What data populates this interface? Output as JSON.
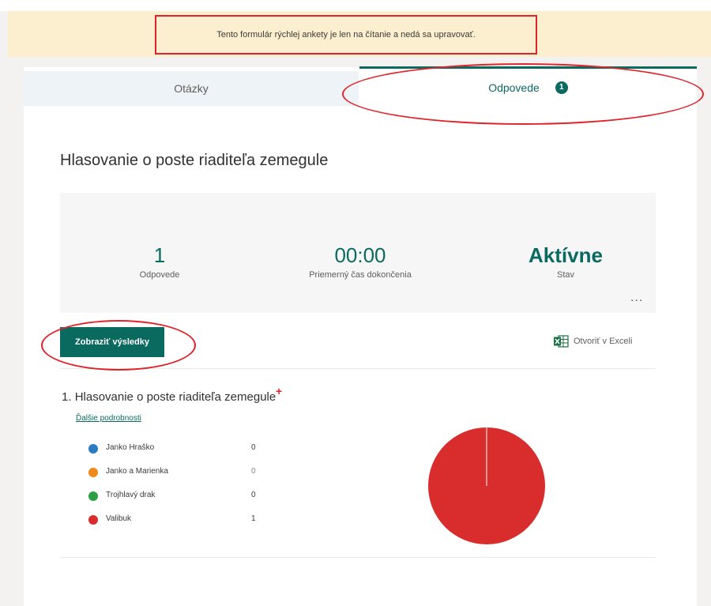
{
  "banner": {
    "message": "Tento formulár rýchlej ankety je len na čítanie a nedá sa upravovať."
  },
  "tabs": [
    {
      "label": "Otázky",
      "selected": false
    },
    {
      "label": "Odpovede",
      "badge": "1",
      "selected": true
    }
  ],
  "form": {
    "title": "Hlasovanie o poste riaditeľa zemegule"
  },
  "stats": {
    "responses": {
      "value": "1",
      "label": "Odpovede"
    },
    "avg_time": {
      "value": "00:00",
      "label": "Priemerný čas dokončenia"
    },
    "status": {
      "value": "Aktívne",
      "label": "Stav"
    },
    "more": "..."
  },
  "actions": {
    "view_results": "Zobraziť výsledky",
    "open_excel": "Otvoriť v Exceli"
  },
  "question": {
    "number": "1.",
    "title": "Hlasovanie o poste riaditeľa zemegule",
    "details_link": "Ďalšie podrobnosti",
    "options": [
      {
        "name": "Janko Hraško",
        "count": "0",
        "color": "#2b7bc0"
      },
      {
        "name": "Janko a Marienka",
        "count": "0",
        "color": "#f08a1c"
      },
      {
        "name": "Trojhlavý drak",
        "count": "0",
        "color": "#2ea043"
      },
      {
        "name": "Valibuk",
        "count": "1",
        "color": "#d92d2d"
      }
    ]
  },
  "colors": {
    "accent": "#0b6a60",
    "annotation": "#e0242b",
    "banner_bg": "#fcefcf"
  }
}
